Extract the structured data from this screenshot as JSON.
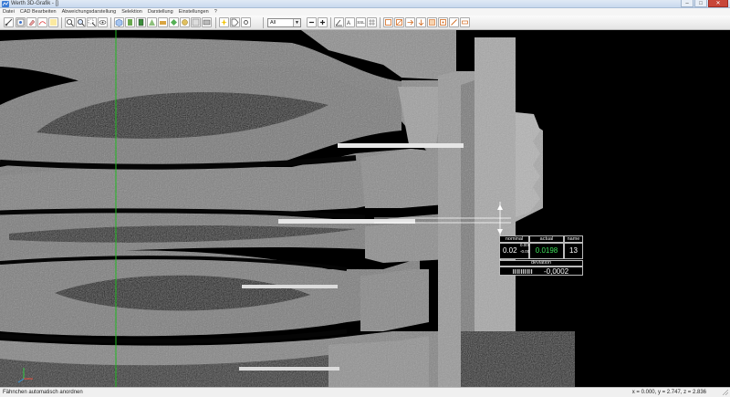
{
  "window": {
    "title": "Werth 3D-Grafik - []",
    "controls": [
      "–",
      "□",
      "✕"
    ]
  },
  "menu": [
    "Datei",
    "CAD Bearbeiten",
    "Abweichungsdarstellung",
    "Selektion",
    "Darstellung",
    "Einstellungen",
    "?"
  ],
  "toolbar": {
    "filter_select": "All",
    "buttons": [
      "measure",
      "select",
      "eraser",
      "cut",
      "blank",
      "zoom-in",
      "zoom-fit",
      "zoom-out",
      "pan",
      "eye",
      "cube",
      "section1",
      "section2",
      "section3",
      "section4",
      "section5",
      "section6",
      "section7",
      "zoom-minus",
      "zoom-plus",
      "angle",
      "text",
      "ssl-label",
      "arrow1",
      "arrow2",
      "arrow3",
      "arrow4",
      "arrow5",
      "arrow6",
      "arrow7",
      "arrow8"
    ],
    "ssl_label": "SSL"
  },
  "measurement": {
    "headers": {
      "nominal": "nominal",
      "actual": "actual",
      "name": "name"
    },
    "nominal": "0.02",
    "tol_plus": "0.005",
    "tol_minus": "-0.005",
    "actual": "0.0198",
    "name": "13",
    "deviation_label": "deviation",
    "deviation": "-0,0002",
    "actual_color": "#3ee05a"
  },
  "status": {
    "left": "Fähnchen automatisch anordnen",
    "right": "x = 0.000, y = 2.747, z = 2.836"
  },
  "colors": {
    "green_axis": "#1fb91f",
    "part": "#8c8c8c",
    "background": "#000000"
  }
}
